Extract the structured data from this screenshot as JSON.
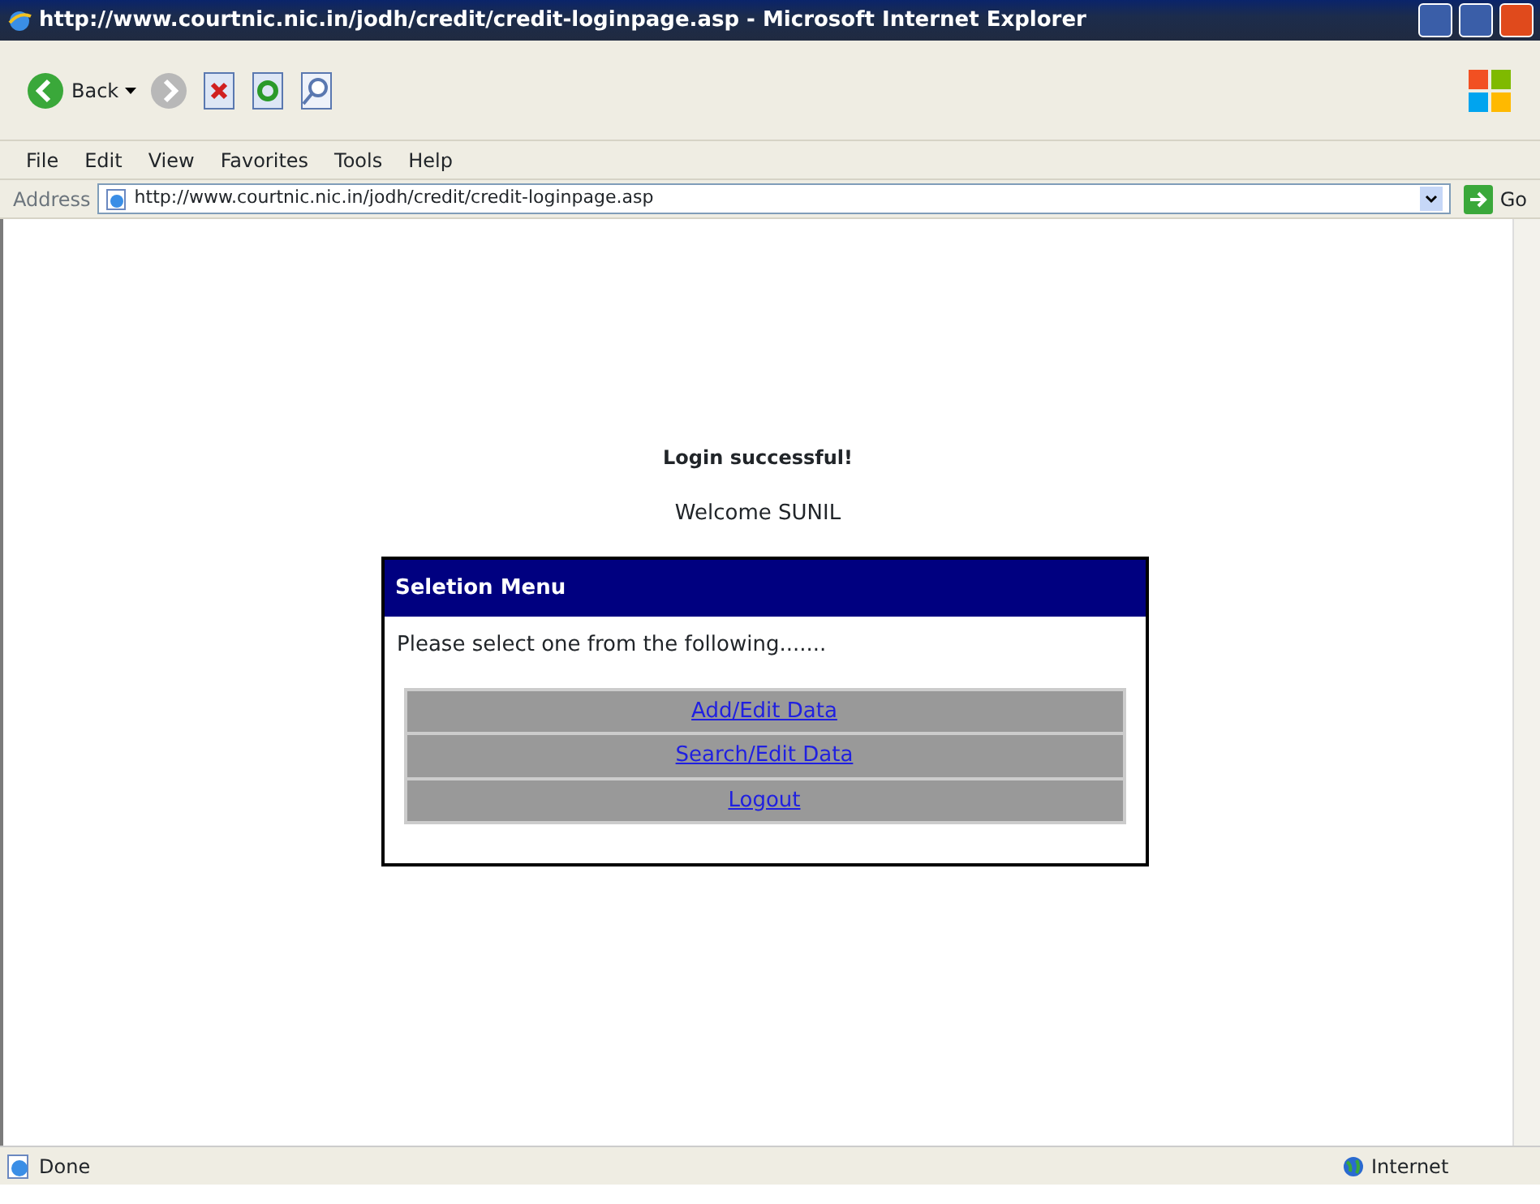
{
  "window": {
    "title": "http://www.courtnic.nic.in/jodh/credit/credit-loginpage.asp - Microsoft Internet Explorer"
  },
  "toolbar": {
    "back_label": "Back"
  },
  "menu": [
    "File",
    "Edit",
    "View",
    "Favorites",
    "Tools",
    "Help"
  ],
  "address_bar": {
    "label": "Address",
    "value": "http://www.courtnic.nic.in/jodh/credit/credit-loginpage.asp",
    "go_label": "Go"
  },
  "page": {
    "heading": "Login successful!",
    "welcome": "Welcome SUNIL",
    "panel": {
      "title": "Seletion Menu",
      "prompt": "Please select one from the following.......",
      "links": [
        "Add/Edit Data",
        "Search/Edit Data",
        "Logout"
      ]
    }
  },
  "status_bar": {
    "status": "Done",
    "zone": "Internet"
  }
}
